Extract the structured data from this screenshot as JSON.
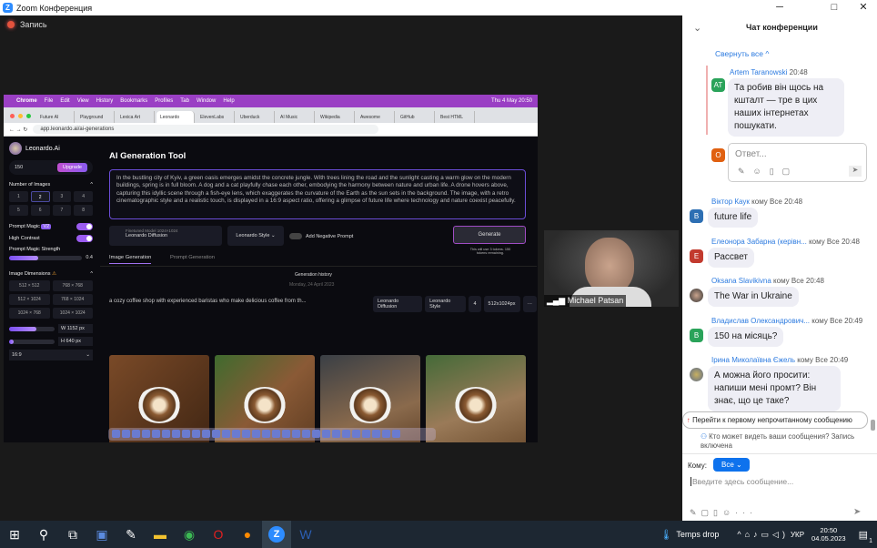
{
  "window": {
    "title": "Zoom Конференция",
    "minimize": "─",
    "maximize": "□",
    "close": "✕",
    "recording": "Запись"
  },
  "shared": {
    "menubar": {
      "items": [
        "Chrome",
        "File",
        "Edit",
        "View",
        "History",
        "Bookmarks",
        "Profiles",
        "Tab",
        "Window",
        "Help"
      ],
      "clock": "Thu 4 May 20:50"
    },
    "tabs": [
      "Future AI",
      "Playground",
      "Lexica Art",
      "Leonardo",
      "ElevenLabs",
      "Uberduck",
      "AI Music",
      "Wikipedia",
      "Awesome",
      "GitHub",
      "Best HTML"
    ],
    "url": "app.leonardo.ai/ai-generations",
    "sidebar": {
      "brand": "Leonardo.Ai",
      "tokens": "150",
      "upgrade": "Upgrade",
      "num_images_label": "Number of Images",
      "num_images": [
        "1",
        "2",
        "3",
        "4",
        "5",
        "6",
        "7",
        "8"
      ],
      "selected_num": "2",
      "prompt_magic": "Prompt Magic",
      "prompt_magic_badge": "V2",
      "high_contrast": "High Contrast",
      "magic_strength": "Prompt Magic Strength",
      "magic_strength_value": "0.4",
      "magic_strength_fraction": 0.4,
      "dimensions_label": "Image Dimensions",
      "dimensions": [
        "512 × 512",
        "768 × 768",
        "512 × 1024",
        "768 × 1024",
        "1024 × 768",
        "1024 × 1024"
      ],
      "width_label": "W",
      "width_value": "1152",
      "height_label": "H",
      "height_value": "640",
      "unit": "px",
      "width_fraction": 0.6,
      "height_fraction": 0.1,
      "aspect": "16:9"
    },
    "main": {
      "title": "AI Generation Tool",
      "prompt": "In the bustling city of Kyiv, a green oasis emerges amidst the concrete jungle. With trees lining the road and the sunlight casting a warm glow on the modern buildings, spring is in full bloom. A dog and a cat playfully chase each other, embodying the harmony between nature and urban life. A drone hovers above, capturing this idyllic scene through a fish-eye lens, which exaggerates the curvature of the Earth as the sun sets in the background. The image, with a retro cinematographic style and a realistic touch, is displayed in a 16:9 aspect ratio, offering a glimpse of future life where technology and nature coexist peacefully.",
      "model_caption": "Finetuned Model",
      "model_res": "1024×1024",
      "model": "Leonardo Diffusion",
      "style": "Leonardo Style",
      "negative": "Add Negative Prompt",
      "generate": "Generate",
      "generate_note": "This will use 3 tokens. 150 tokens remaining.",
      "tabs": [
        "Image Generation",
        "Prompt Generation"
      ],
      "history": "Generation history",
      "date": "Monday, 24 April 2023",
      "gen_prompt": "a cozy coffee shop with experienced baristas who make delicious coffee from th...",
      "gen_tags": [
        "Leonardo Diffusion",
        "Leonardo Style",
        "4",
        "512x1024px",
        "···"
      ]
    }
  },
  "video": {
    "name": "Michael Patsan"
  },
  "chat": {
    "title": "Чат конференции",
    "collapse": "Свернуть все ^",
    "reply_placeholder": "Ответ...",
    "messages": [
      {
        "name": "Artem Taranowski",
        "to": "",
        "time": "20:48",
        "text": "Та робив він щось на кшталт — тре в цих наших інтернетах пошукати.",
        "avatar": "AT",
        "color": "#2aa35a"
      },
      {
        "name": "Віктор Каук",
        "to": "кому Все",
        "time": "20:48",
        "text": "future life",
        "avatar": "В",
        "color": "#2d6fb3"
      },
      {
        "name": "Елеонора Забарна (керівн...",
        "to": "кому Все",
        "time": "20:48",
        "text": "Рассвет",
        "avatar": "Е",
        "color": "#c23a2e"
      },
      {
        "name": "Oksana Slavikivna",
        "to": "кому Все",
        "time": "20:48",
        "text": "The War in Ukraine",
        "avatar": "",
        "color": "#666"
      },
      {
        "name": "Владислав Олександрович...",
        "to": "кому Все",
        "time": "20:49",
        "text": "150 на місяць?",
        "avatar": "В",
        "color": "#2aa35a"
      },
      {
        "name": "Ірина Миколаївна Єжель",
        "to": "кому Все",
        "time": "20:49",
        "text": "А можна його просити: напиши мені промт? Він знає, що це таке?",
        "avatar": "",
        "color": "#8896a8"
      }
    ],
    "reply_avatar": "O",
    "jump": "Перейти к первому непрочитанному сообщению",
    "privacy": "Кто может видеть ваши сообщения? Запись включена",
    "to_label": "Кому:",
    "to_value": "Все",
    "input_placeholder": "Введите здесь сообщение..."
  },
  "taskbar": {
    "weather": "Temps drop",
    "lang": "УКР",
    "time": "20:50",
    "date": "04.05.2023",
    "notif": "1"
  }
}
